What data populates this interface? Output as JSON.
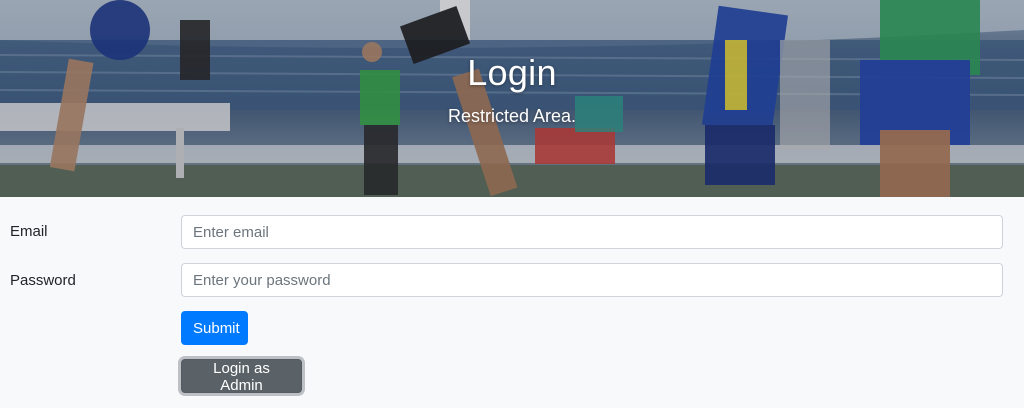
{
  "hero": {
    "title": "Login",
    "subtitle": "Restricted Area."
  },
  "form": {
    "email": {
      "label": "Email",
      "placeholder": "Enter email",
      "value": ""
    },
    "password": {
      "label": "Password",
      "placeholder": "Enter your password",
      "value": ""
    },
    "submit_label": "Submit",
    "admin_label": "Login as Admin"
  },
  "colors": {
    "primary": "#007bff",
    "secondary": "#5a6268",
    "page_background": "#f8f9fa"
  }
}
